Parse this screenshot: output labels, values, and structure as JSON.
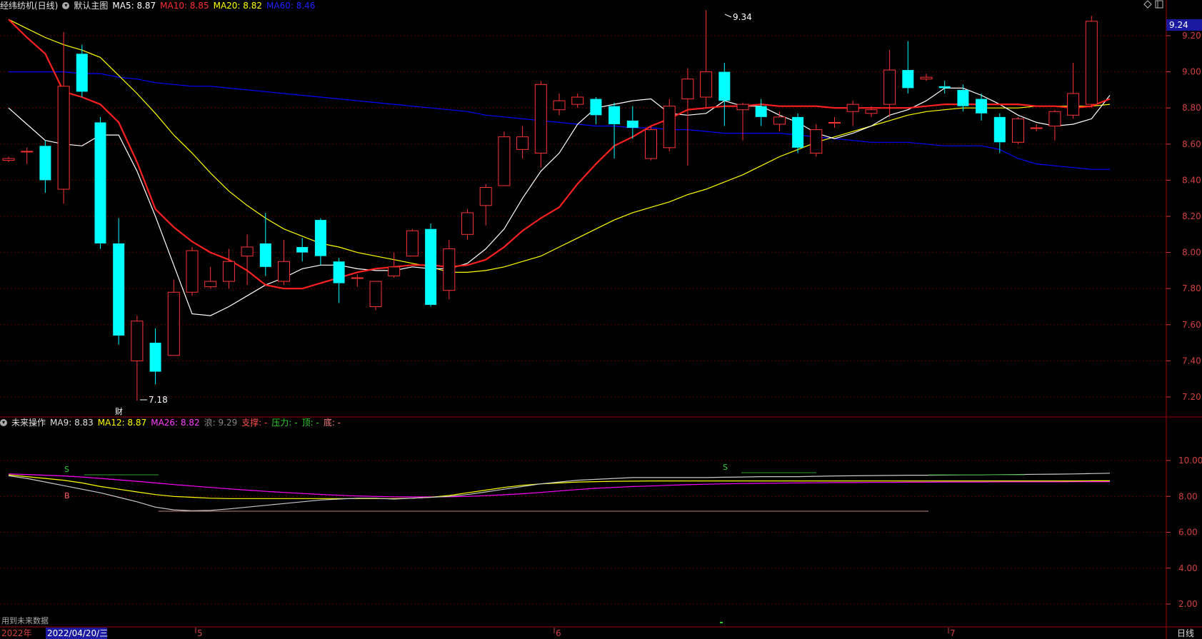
{
  "colors": {
    "bg": "#000000",
    "up": "#ff3232",
    "down": "#00ffff",
    "ma5": "#ffffff",
    "ma10": "#ff2020",
    "ma20": "#ffff00",
    "ma60": "#0000ff",
    "grid": "#5a0000",
    "frame": "#a00000",
    "axis_text": "#d04040",
    "ma9": "#c8c8c8",
    "ma12": "#ffff00",
    "ma26": "#ff00ff"
  },
  "main": {
    "title": "经纬纺机(日线)",
    "indicator_name": "默认主图",
    "ma5": "MA5: 8.87",
    "ma10": "MA10: 8.85",
    "ma20": "MA20: 8.82",
    "ma60": "MA60: 8.46",
    "last_price": "9.24",
    "high_label": "9.34",
    "low_label": "7.18",
    "low_marker": "财"
  },
  "sub": {
    "title": "未来操作",
    "ma9": "MA9: 8.83",
    "ma12": "MA12: 8.87",
    "ma26": "MA26: 8.82",
    "lang": "浪: 9.29",
    "zhicheng": "支撑: -",
    "yali": "压力: -",
    "ding": "顶: -",
    "di": "底: -",
    "sig_s1": "S",
    "sig_b1": "B",
    "sig_s2": "S",
    "footer_note": "用到未来数据"
  },
  "xaxis": {
    "year": "2022年",
    "cursor_date": "2022/04/20/三",
    "months": [
      "5",
      "6",
      "7"
    ],
    "period": "日线"
  },
  "icons": {
    "diamond": "diamond-icon",
    "window": "window-icon"
  },
  "chart_data": {
    "type": "candlestick",
    "y_ticks_main": [
      "9.20",
      "9.00",
      "8.80",
      "8.60",
      "8.40",
      "8.20",
      "8.00",
      "7.80",
      "7.60",
      "7.40",
      "7.20"
    ],
    "y_ticks_sub": [
      "10.00",
      "8.00",
      "6.00",
      "4.00",
      "2.00"
    ],
    "candles": [
      [
        8.51,
        8.52,
        8.5,
        8.53
      ],
      [
        8.56,
        8.56,
        8.49,
        8.58
      ],
      [
        8.59,
        8.4,
        8.33,
        8.62
      ],
      [
        8.35,
        8.92,
        8.27,
        9.22
      ],
      [
        9.1,
        8.89,
        8.86,
        9.15
      ],
      [
        8.72,
        8.05,
        8.02,
        8.75
      ],
      [
        8.05,
        7.54,
        7.49,
        8.19
      ],
      [
        7.4,
        7.62,
        7.18,
        7.65
      ],
      [
        7.5,
        7.34,
        7.27,
        7.58
      ],
      [
        7.43,
        7.78,
        7.43,
        7.85
      ],
      [
        7.78,
        8.01,
        7.76,
        8.03
      ],
      [
        7.81,
        7.84,
        7.8,
        7.92
      ],
      [
        7.84,
        7.95,
        7.8,
        8.02
      ],
      [
        7.98,
        8.03,
        7.82,
        8.1
      ],
      [
        8.05,
        7.92,
        7.87,
        8.22
      ],
      [
        7.84,
        7.95,
        7.82,
        8.07
      ],
      [
        8.03,
        8.0,
        7.95,
        8.08
      ],
      [
        8.18,
        7.98,
        7.93,
        8.19
      ],
      [
        7.95,
        7.83,
        7.72,
        7.97
      ],
      [
        7.86,
        7.86,
        7.81,
        7.88
      ],
      [
        7.7,
        7.84,
        7.68,
        7.84
      ],
      [
        7.87,
        7.92,
        7.86,
        8.0
      ],
      [
        7.98,
        8.12,
        7.98,
        8.13
      ],
      [
        8.13,
        7.71,
        7.7,
        8.16
      ],
      [
        7.79,
        8.02,
        7.74,
        8.07
      ],
      [
        8.1,
        8.22,
        8.07,
        8.24
      ],
      [
        8.26,
        8.36,
        8.15,
        8.38
      ],
      [
        8.37,
        8.64,
        8.37,
        8.67
      ],
      [
        8.57,
        8.64,
        8.52,
        8.7
      ],
      [
        8.55,
        8.93,
        8.47,
        8.95
      ],
      [
        8.79,
        8.84,
        8.76,
        8.88
      ],
      [
        8.82,
        8.86,
        8.8,
        8.88
      ],
      [
        8.85,
        8.76,
        8.71,
        8.86
      ],
      [
        8.81,
        8.71,
        8.52,
        8.83
      ],
      [
        8.73,
        8.69,
        8.63,
        8.81
      ],
      [
        8.52,
        8.68,
        8.51,
        8.7
      ],
      [
        8.58,
        8.81,
        8.56,
        8.85
      ],
      [
        8.85,
        8.96,
        8.48,
        9.02
      ],
      [
        8.86,
        9.0,
        8.8,
        9.34
      ],
      [
        9.0,
        8.84,
        8.7,
        9.05
      ],
      [
        8.79,
        8.82,
        8.62,
        8.83
      ],
      [
        8.81,
        8.75,
        8.7,
        8.85
      ],
      [
        8.71,
        8.75,
        8.67,
        8.78
      ],
      [
        8.75,
        8.58,
        8.55,
        8.77
      ],
      [
        8.55,
        8.68,
        8.53,
        8.71
      ],
      [
        8.72,
        8.72,
        8.69,
        8.75
      ],
      [
        8.78,
        8.82,
        8.7,
        8.84
      ],
      [
        8.77,
        8.79,
        8.75,
        8.81
      ],
      [
        8.82,
        9.01,
        8.75,
        9.12
      ],
      [
        9.01,
        8.91,
        8.88,
        9.17
      ],
      [
        8.96,
        8.97,
        8.95,
        8.99
      ],
      [
        8.92,
        8.91,
        8.88,
        8.95
      ],
      [
        8.9,
        8.81,
        8.78,
        8.93
      ],
      [
        8.85,
        8.77,
        8.73,
        8.88
      ],
      [
        8.75,
        8.61,
        8.55,
        8.77
      ],
      [
        8.61,
        8.74,
        8.6,
        8.75
      ],
      [
        8.69,
        8.69,
        8.67,
        8.71
      ],
      [
        8.7,
        8.78,
        8.62,
        8.79
      ],
      [
        8.76,
        8.88,
        8.74,
        9.05
      ],
      [
        8.82,
        9.28,
        8.8,
        9.31
      ]
    ],
    "ma5": [
      8.8,
      8.71,
      8.62,
      8.6,
      8.59,
      8.65,
      8.65,
      8.45,
      8.2,
      7.93,
      7.66,
      7.65,
      7.7,
      7.76,
      7.82,
      7.86,
      7.91,
      7.93,
      7.93,
      7.91,
      7.9,
      7.9,
      7.92,
      7.91,
      7.91,
      7.94,
      8.02,
      8.13,
      8.3,
      8.45,
      8.55,
      8.71,
      8.8,
      8.82,
      8.84,
      8.85,
      8.77,
      8.76,
      8.77,
      8.84,
      8.81,
      8.81,
      8.76,
      8.72,
      8.66,
      8.63,
      8.66,
      8.7,
      8.76,
      8.79,
      8.84,
      8.91,
      8.91,
      8.87,
      8.82,
      8.76,
      8.72,
      8.7,
      8.71,
      8.74,
      8.87
    ],
    "ma10": [
      9.29,
      9.19,
      9.1,
      8.89,
      8.86,
      8.82,
      8.72,
      8.5,
      8.24,
      8.14,
      8.06,
      8.0,
      7.96,
      7.9,
      7.82,
      7.8,
      7.8,
      7.83,
      7.86,
      7.89,
      7.91,
      7.92,
      7.93,
      7.93,
      7.92,
      7.93,
      7.96,
      8.03,
      8.12,
      8.19,
      8.25,
      8.38,
      8.49,
      8.59,
      8.64,
      8.7,
      8.74,
      8.79,
      8.8,
      8.81,
      8.81,
      8.82,
      8.81,
      8.81,
      8.81,
      8.8,
      8.8,
      8.8,
      8.8,
      8.8,
      8.81,
      8.82,
      8.82,
      8.82,
      8.82,
      8.82,
      8.81,
      8.81,
      8.8,
      8.81,
      8.85
    ],
    "ma20": [
      9.29,
      9.24,
      9.19,
      9.15,
      9.12,
      9.08,
      8.98,
      8.88,
      8.77,
      8.65,
      8.55,
      8.44,
      8.34,
      8.26,
      8.19,
      8.13,
      8.09,
      8.05,
      8.03,
      8.0,
      7.98,
      7.96,
      7.94,
      7.92,
      7.89,
      7.89,
      7.9,
      7.92,
      7.95,
      7.98,
      8.03,
      8.08,
      8.13,
      8.18,
      8.22,
      8.25,
      8.28,
      8.32,
      8.35,
      8.39,
      8.43,
      8.48,
      8.53,
      8.57,
      8.61,
      8.64,
      8.67,
      8.7,
      8.73,
      8.76,
      8.78,
      8.79,
      8.8,
      8.8,
      8.8,
      8.8,
      8.81,
      8.81,
      8.81,
      8.81,
      8.82
    ],
    "ma60": [
      9.0,
      9.0,
      9.0,
      9.0,
      8.99,
      8.99,
      8.97,
      8.96,
      8.94,
      8.93,
      8.92,
      8.92,
      8.91,
      8.9,
      8.89,
      8.88,
      8.87,
      8.86,
      8.85,
      8.84,
      8.83,
      8.82,
      8.81,
      8.8,
      8.79,
      8.78,
      8.76,
      8.75,
      8.74,
      8.73,
      8.72,
      8.71,
      8.7,
      8.7,
      8.69,
      8.69,
      8.68,
      8.68,
      8.67,
      8.66,
      8.66,
      8.66,
      8.66,
      8.65,
      8.64,
      8.63,
      8.62,
      8.61,
      8.61,
      8.61,
      8.6,
      8.59,
      8.59,
      8.59,
      8.57,
      8.52,
      8.49,
      8.48,
      8.47,
      8.46,
      8.46
    ],
    "sub_ma9": [
      9.15,
      9.0,
      8.8,
      8.6,
      8.4,
      8.2,
      7.95,
      7.7,
      7.4,
      7.25,
      7.2,
      7.22,
      7.3,
      7.4,
      7.5,
      7.6,
      7.7,
      7.8,
      7.85,
      7.9,
      7.9,
      7.85,
      7.9,
      7.95,
      8.0,
      8.1,
      8.25,
      8.4,
      8.55,
      8.7,
      8.8,
      8.9,
      8.95,
      9.0,
      9.05,
      9.05,
      9.05,
      9.05,
      9.05,
      9.07,
      9.08,
      9.1,
      9.1,
      9.1,
      9.12,
      9.14,
      9.15,
      9.16,
      9.17,
      9.18,
      9.18,
      9.19,
      9.2,
      9.2,
      9.21,
      9.22,
      9.23,
      9.24,
      9.25,
      9.27,
      9.29
    ],
    "sub_ma12": [
      9.2,
      9.1,
      9.0,
      8.9,
      8.75,
      8.55,
      8.4,
      8.25,
      8.1,
      8.0,
      7.95,
      7.9,
      7.88,
      7.88,
      7.88,
      7.88,
      7.88,
      7.88,
      7.88,
      7.88,
      7.88,
      7.88,
      7.9,
      7.95,
      8.05,
      8.2,
      8.35,
      8.5,
      8.62,
      8.7,
      8.75,
      8.8,
      8.82,
      8.84,
      8.85,
      8.86,
      8.86,
      8.86,
      8.86,
      8.86,
      8.86,
      8.86,
      8.86,
      8.86,
      8.86,
      8.86,
      8.86,
      8.86,
      8.86,
      8.86,
      8.86,
      8.86,
      8.86,
      8.86,
      8.86,
      8.86,
      8.86,
      8.86,
      8.86,
      8.87,
      8.87
    ],
    "sub_ma26": [
      9.25,
      9.22,
      9.18,
      9.14,
      9.08,
      9.0,
      8.92,
      8.84,
      8.75,
      8.66,
      8.58,
      8.5,
      8.42,
      8.35,
      8.28,
      8.22,
      8.16,
      8.11,
      8.06,
      8.02,
      8.0,
      7.98,
      7.97,
      7.97,
      7.98,
      8.0,
      8.04,
      8.09,
      8.15,
      8.22,
      8.3,
      8.38,
      8.45,
      8.5,
      8.55,
      8.58,
      8.62,
      8.65,
      8.68,
      8.7,
      8.72,
      8.73,
      8.74,
      8.75,
      8.76,
      8.77,
      8.77,
      8.78,
      8.78,
      8.79,
      8.79,
      8.8,
      8.8,
      8.8,
      8.81,
      8.81,
      8.81,
      8.81,
      8.82,
      8.82,
      8.82
    ]
  }
}
